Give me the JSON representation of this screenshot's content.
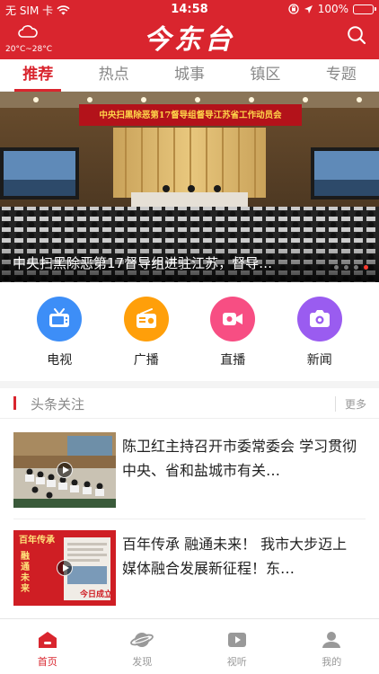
{
  "status_bar": {
    "carrier": "无 SIM 卡",
    "time": "14:58",
    "battery": "100%",
    "battery_level": 1.0
  },
  "header": {
    "logo_text": "今东台",
    "weather_icon": "cloud-icon",
    "weather_temp": "20°C~28°C",
    "search_icon": "search-icon"
  },
  "tabs": [
    {
      "label": "推荐",
      "active": true
    },
    {
      "label": "热点",
      "active": false
    },
    {
      "label": "城事",
      "active": false
    },
    {
      "label": "镇区",
      "active": false
    },
    {
      "label": "专题",
      "active": false
    }
  ],
  "banner": {
    "caption": "中央扫黑除恶第17督导组进驻江苏，督导…",
    "stage_banner_text": "中央扫黑除恶第17督导组督导江苏省工作动员会",
    "slides": 4,
    "active_slide": 4
  },
  "quick_links": [
    {
      "label": "电视",
      "icon": "tv-icon",
      "color": "#3d8ef7"
    },
    {
      "label": "广播",
      "icon": "radio-icon",
      "color": "#ff9f0a"
    },
    {
      "label": "直播",
      "icon": "video-camera-icon",
      "color": "#f74e83"
    },
    {
      "label": "新闻",
      "icon": "camera-icon",
      "color": "#9a5cf0"
    }
  ],
  "section": {
    "title": "头条关注",
    "more": "更多"
  },
  "news": [
    {
      "title": "陈卫红主持召开市委常委会  学习贯彻中央、省和盐城市有关…",
      "has_video": true
    },
    {
      "title": "百年传承 融通未来！  我市大步迈上媒体融合发展新征程！东…",
      "has_video": true,
      "thumb_text_1": "百年传承",
      "thumb_text_2": "融通未来",
      "thumb_text_3": "今日成立"
    }
  ],
  "bottom_nav": [
    {
      "label": "首页",
      "icon": "home-icon",
      "active": true
    },
    {
      "label": "发现",
      "icon": "planet-icon",
      "active": false
    },
    {
      "label": "视听",
      "icon": "play-icon",
      "active": false
    },
    {
      "label": "我的",
      "icon": "user-icon",
      "active": false
    }
  ],
  "colors": {
    "brand_red": "#d9252e"
  }
}
